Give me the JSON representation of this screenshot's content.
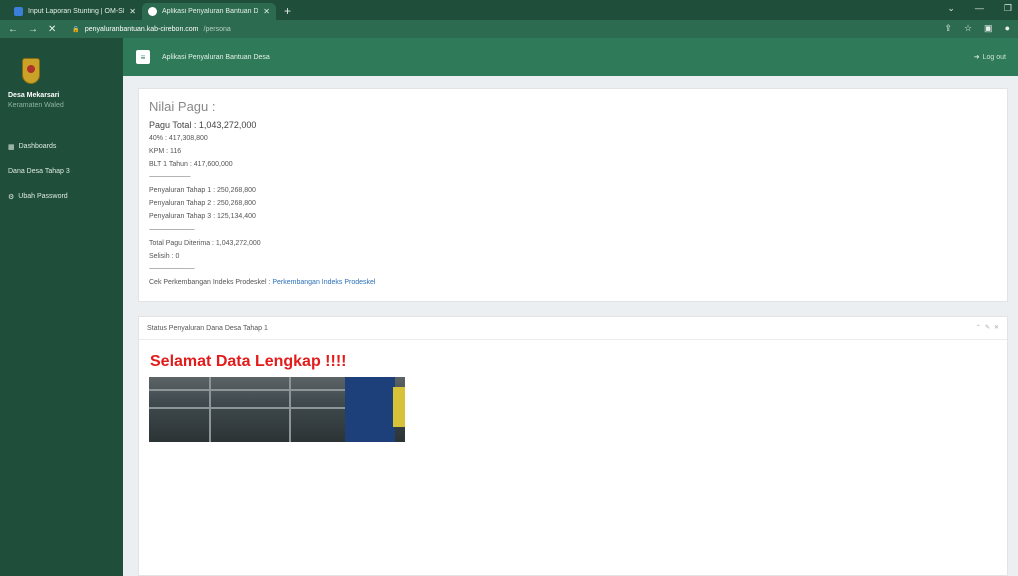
{
  "browser": {
    "tabs": [
      {
        "title": "Input Laporan Stunting | OM-SPI",
        "active": false
      },
      {
        "title": "Aplikasi Penyaluran Bantuan Des",
        "active": true
      }
    ],
    "url_host": "penyaluranbantuan.kab-cirebon.com",
    "url_path": "/persona"
  },
  "sidebar": {
    "user_name": "Desa Mekarsari",
    "user_sub": "Keramaten Waled",
    "items": [
      {
        "label": "Dashboards",
        "icon": "grid-icon"
      },
      {
        "label": "Dana Desa Tahap 3",
        "icon": ""
      },
      {
        "label": "Ubah Password",
        "icon": "gear-icon"
      }
    ]
  },
  "header": {
    "title": "Aplikasi Penyaluran Bantuan Desa",
    "logout": "Log out"
  },
  "pagu": {
    "heading": "Nilai Pagu :",
    "total": "Pagu Total : 1,043,272,000",
    "line_40": "40% : 417,308,800",
    "kpm": "KPM : 116",
    "blt": "BLT 1 Tahun : 417,600,000",
    "divider1": "-----------------------------------------",
    "tahap1": "Penyaluran Tahap 1 : 250,268,800",
    "tahap2": "Penyaluran Tahap 2 : 250,268,800",
    "tahap3": "Penyaluran Tahap 3 : 125,134,400",
    "divider2": "---------------------------------------------",
    "total_diterima": "Total Pagu Diterima : 1,043,272,000",
    "selisih": "Selisih : 0",
    "divider3": "---------------------------------------------",
    "cek_label": "Cek Perkembangan Indeks Prodeskel :",
    "cek_link": "Perkembangan Indeks Prodeskel"
  },
  "status_panel": {
    "title": "Status Penyaluran Dana Desa Tahap 1",
    "message": "Selamat Data Lengkap !!!!"
  },
  "colors": {
    "sidebar": "#1f4f3a",
    "header": "#2f7a58",
    "message": "#e31b1b",
    "link": "#2c6fb7"
  }
}
